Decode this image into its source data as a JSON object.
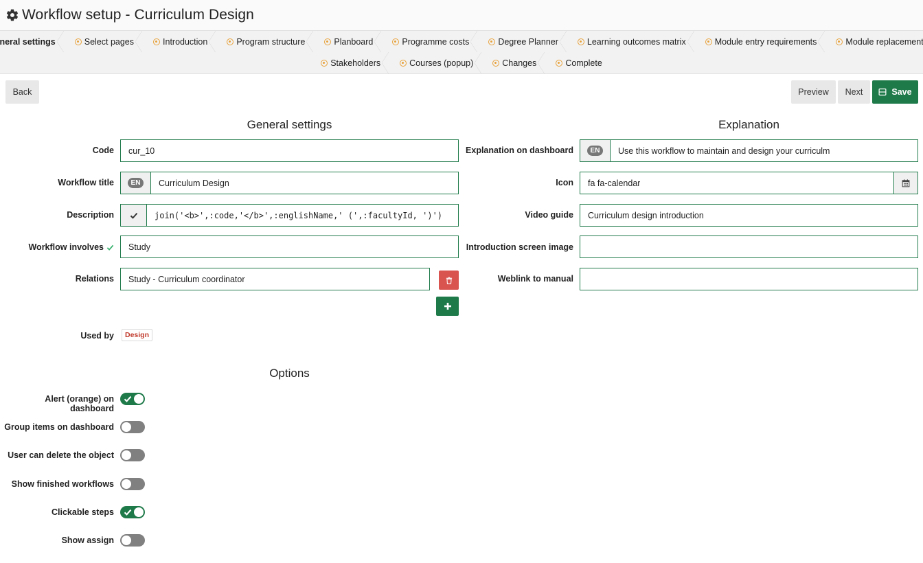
{
  "header": {
    "title": "Workflow setup - Curriculum Design",
    "icon": "gear-icon"
  },
  "steps": {
    "row1": [
      "General settings",
      "Select pages",
      "Introduction",
      "Program structure",
      "Planboard",
      "Programme costs",
      "Degree Planner",
      "Learning outcomes matrix",
      "Module entry requirements",
      "Module replacement rules"
    ],
    "row2": [
      "Stakeholders",
      "Courses (popup)",
      "Changes",
      "Complete"
    ],
    "active": "General settings"
  },
  "toolbar": {
    "back": "Back",
    "preview": "Preview",
    "next": "Next",
    "save": "Save"
  },
  "general": {
    "title": "General settings",
    "code_label": "Code",
    "code_value": "cur_10",
    "wtitle_label": "Workflow title",
    "wtitle_lang": "EN",
    "wtitle_value": "Curriculum Design",
    "desc_label": "Description",
    "desc_value": "join('<b>',:code,'</b>',:englishName,' (',:facultyId, ')')",
    "involves_label": "Workflow involves",
    "involves_value": "Study",
    "relations_label": "Relations",
    "relations_value": "Study - Curriculum coordinator",
    "usedby_label": "Used by",
    "usedby_tag": "Design"
  },
  "explanation": {
    "title": "Explanation",
    "dash_label": "Explanation on dashboard",
    "dash_lang": "EN",
    "dash_value": "Use this workflow to maintain and design your curriculm",
    "icon_label": "Icon",
    "icon_value": "fa fa-calendar",
    "video_label": "Video guide",
    "video_value": "Curriculum design introduction",
    "image_label": "Introduction screen image",
    "image_value": "",
    "weblink_label": "Weblink to manual",
    "weblink_value": ""
  },
  "options": {
    "title": "Options",
    "items": [
      {
        "label": "Alert (orange) on dashboard",
        "on": true
      },
      {
        "label": "Group items on dashboard",
        "on": false
      },
      {
        "label": "User can delete the object",
        "on": false
      },
      {
        "label": "Show finished workflows",
        "on": false
      },
      {
        "label": "Clickable steps",
        "on": true
      },
      {
        "label": "Show assign",
        "on": false
      }
    ]
  },
  "colors": {
    "primary": "#1f7a4a",
    "danger": "#d9534f",
    "step_dot": "#e8a23c",
    "tag_text": "#c0392b"
  }
}
